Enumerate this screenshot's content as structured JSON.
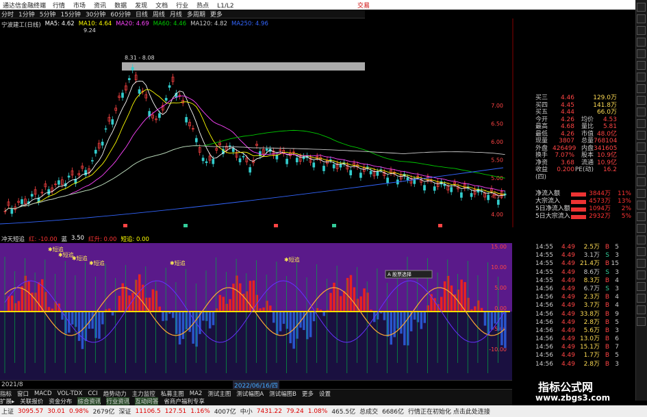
{
  "titlebar": {
    "app": "通达信金融终端",
    "menu": [
      "行情",
      "市场",
      "资讯",
      "数据",
      "发现",
      "文档",
      "行业",
      "热点",
      "L1/L2"
    ],
    "right": "交易"
  },
  "toolbar": [
    "分时",
    "1分钟",
    "5分钟",
    "15分钟",
    "30分钟",
    "60分钟",
    "日线",
    "周线",
    "月线",
    "多周期",
    "更多"
  ],
  "main_legend": {
    "name": "宁波建工(日线)",
    "items": [
      {
        "t": "MA5: 4.62",
        "c": "#ffffff"
      },
      {
        "t": "MA10: 4.64",
        "c": "#ffff00"
      },
      {
        "t": "MA20: 4.69",
        "c": "#ff44ff"
      },
      {
        "t": "MA60: 4.46",
        "c": "#00cc00"
      },
      {
        "t": "MA120: 4.82",
        "c": "#cccccc"
      },
      {
        "t": "MA250: 4.96",
        "c": "#3366ff"
      }
    ]
  },
  "main_annot": {
    "high": "9.24",
    "range": "8.31 - 8.08",
    "price_tag": "4.28"
  },
  "price_axis": [
    "7.00",
    "6.50",
    "6.00",
    "5.50",
    "5.00",
    "4.50",
    "4.00"
  ],
  "sub_legend": {
    "name": "冲天短追",
    "items": [
      {
        "t": "红: -10.00",
        "c": "#ff3333"
      },
      {
        "t": "蓝",
        "c": "#ffffff"
      },
      {
        "t": "3.50",
        "c": "#ffffff"
      },
      {
        "t": "红升: 0.00",
        "c": "#ff3333"
      },
      {
        "t": "短追: 0.00",
        "c": "#ffff00"
      }
    ]
  },
  "sub_marks": [
    "短追",
    "短追",
    "短追",
    "短追",
    "短追",
    "短追"
  ],
  "sub_axis": [
    "15.00",
    "10.00",
    "5.00",
    "0.00",
    "-5.00",
    "-10.00"
  ],
  "popup": "A 股票选择",
  "date_axis": {
    "left": "2021/8",
    "center": "2022/06/16/四"
  },
  "quote": {
    "rows": [
      {
        "l": "买三",
        "v": "4.46",
        "l2": "",
        "v2": "129.0万"
      },
      {
        "l": "买四",
        "v": "4.45",
        "l2": "",
        "v2": "141.8万"
      },
      {
        "l": "买五",
        "v": "4.44",
        "l2": "",
        "v2": "66.0万"
      }
    ],
    "stats": [
      {
        "l": "今开",
        "v": "4.26",
        "l2": "均价",
        "v2": "4.53"
      },
      {
        "l": "最高",
        "v": "4.68",
        "l2": "量比",
        "v2": "5.81"
      },
      {
        "l": "最低",
        "v": "4.26",
        "l2": "市值",
        "v2": "48.0亿"
      },
      {
        "l": "现量",
        "v": "3807",
        "l2": "总量",
        "v2": "768104"
      },
      {
        "l": "外盘",
        "v": "426499",
        "l2": "内盘",
        "v2": "341605"
      },
      {
        "l": "换手",
        "v": "7.07%",
        "l2": "股本",
        "v2": "10.9亿"
      },
      {
        "l": "净资",
        "v": "3.68",
        "l2": "流通",
        "v2": "10.9亿"
      },
      {
        "l": "收益(四)",
        "v": "0.200",
        "l2": "PE(动)",
        "v2": "16.2"
      }
    ]
  },
  "flows": [
    {
      "l": "净流入额",
      "v": "3844万",
      "p": "11%"
    },
    {
      "l": "大宗流入",
      "v": "4573万",
      "p": "13%"
    },
    {
      "l": "5日净流入额",
      "v": "1094万",
      "p": "2%"
    },
    {
      "l": "5日大宗流入",
      "v": "2932万",
      "p": "5%"
    }
  ],
  "ticks": [
    {
      "t": "14:55",
      "p": "4.49",
      "v": "2.5万",
      "s": "B",
      "n": "5"
    },
    {
      "t": "14:55",
      "p": "4.49",
      "v": "3.1万",
      "s": "S",
      "n": "3"
    },
    {
      "t": "14:55",
      "p": "4.49",
      "v": "21.4万",
      "s": "B",
      "n": "15"
    },
    {
      "t": "14:55",
      "p": "4.49",
      "v": "8.6万",
      "s": "S",
      "n": "3"
    },
    {
      "t": "14:55",
      "p": "4.49",
      "v": "8.3万",
      "s": "B",
      "n": "4"
    },
    {
      "t": "14:56",
      "p": "4.49",
      "v": "6.7万",
      "s": "S",
      "n": "3"
    },
    {
      "t": "14:56",
      "p": "4.49",
      "v": "2.3万",
      "s": "B",
      "n": "4"
    },
    {
      "t": "14:56",
      "p": "4.49",
      "v": "3.7万",
      "s": "B",
      "n": "4"
    },
    {
      "t": "14:56",
      "p": "4.49",
      "v": "33.8万",
      "s": "B",
      "n": "9"
    },
    {
      "t": "14:56",
      "p": "4.49",
      "v": "2.8万",
      "s": "B",
      "n": "5"
    },
    {
      "t": "14:56",
      "p": "4.49",
      "v": "5.6万",
      "s": "B",
      "n": "3"
    },
    {
      "t": "14:56",
      "p": "4.49",
      "v": "13.0万",
      "s": "B",
      "n": "6"
    },
    {
      "t": "14:56",
      "p": "4.49",
      "v": "15.1万",
      "s": "B",
      "n": "7"
    },
    {
      "t": "14:56",
      "p": "4.49",
      "v": "1.7万",
      "s": "B",
      "n": "5"
    },
    {
      "t": "14:56",
      "p": "4.49",
      "v": "2.8万",
      "s": "B",
      "n": "3"
    }
  ],
  "indtabs": [
    "指标",
    "窗口",
    "MACD",
    "VOL-TDX",
    "CCI",
    "趋势动力",
    "主力监控",
    "私募主图",
    "MA2",
    "测试主图",
    "测试幅图A",
    "测试幅图B",
    "更多",
    "设置"
  ],
  "indtabs2": [
    "扩展▸",
    "关联报价",
    "资金分布",
    "综合资讯",
    "行业资讯",
    "互动问答",
    "省商户福利专享"
  ],
  "status": [
    {
      "t": "上证",
      "c": ""
    },
    {
      "t": "3095.57",
      "c": "up"
    },
    {
      "t": "30.01",
      "c": "up"
    },
    {
      "t": "0.98%",
      "c": "up"
    },
    {
      "t": "2679亿",
      "c": ""
    },
    {
      "t": "深证",
      "c": ""
    },
    {
      "t": "11106.5",
      "c": "up"
    },
    {
      "t": "127.51",
      "c": "up"
    },
    {
      "t": "1.16%",
      "c": "up"
    },
    {
      "t": "4007亿",
      "c": ""
    },
    {
      "t": "中小",
      "c": ""
    },
    {
      "t": "7431.22",
      "c": "up"
    },
    {
      "t": "79.24",
      "c": "up"
    },
    {
      "t": "1.08%",
      "c": "up"
    },
    {
      "t": "465.5亿",
      "c": ""
    },
    {
      "t": "总成交",
      "c": ""
    },
    {
      "t": "6686亿",
      "c": ""
    },
    {
      "t": "行情正在初始化 点击此处连接",
      "c": ""
    }
  ],
  "watermark": {
    "title": "指标公式网",
    "url": "www.zbgs3.com"
  },
  "colors": {
    "up": "#ff3333",
    "down": "#33cc99",
    "purple": "#5a1a8a",
    "blue": "#2a55cc"
  }
}
